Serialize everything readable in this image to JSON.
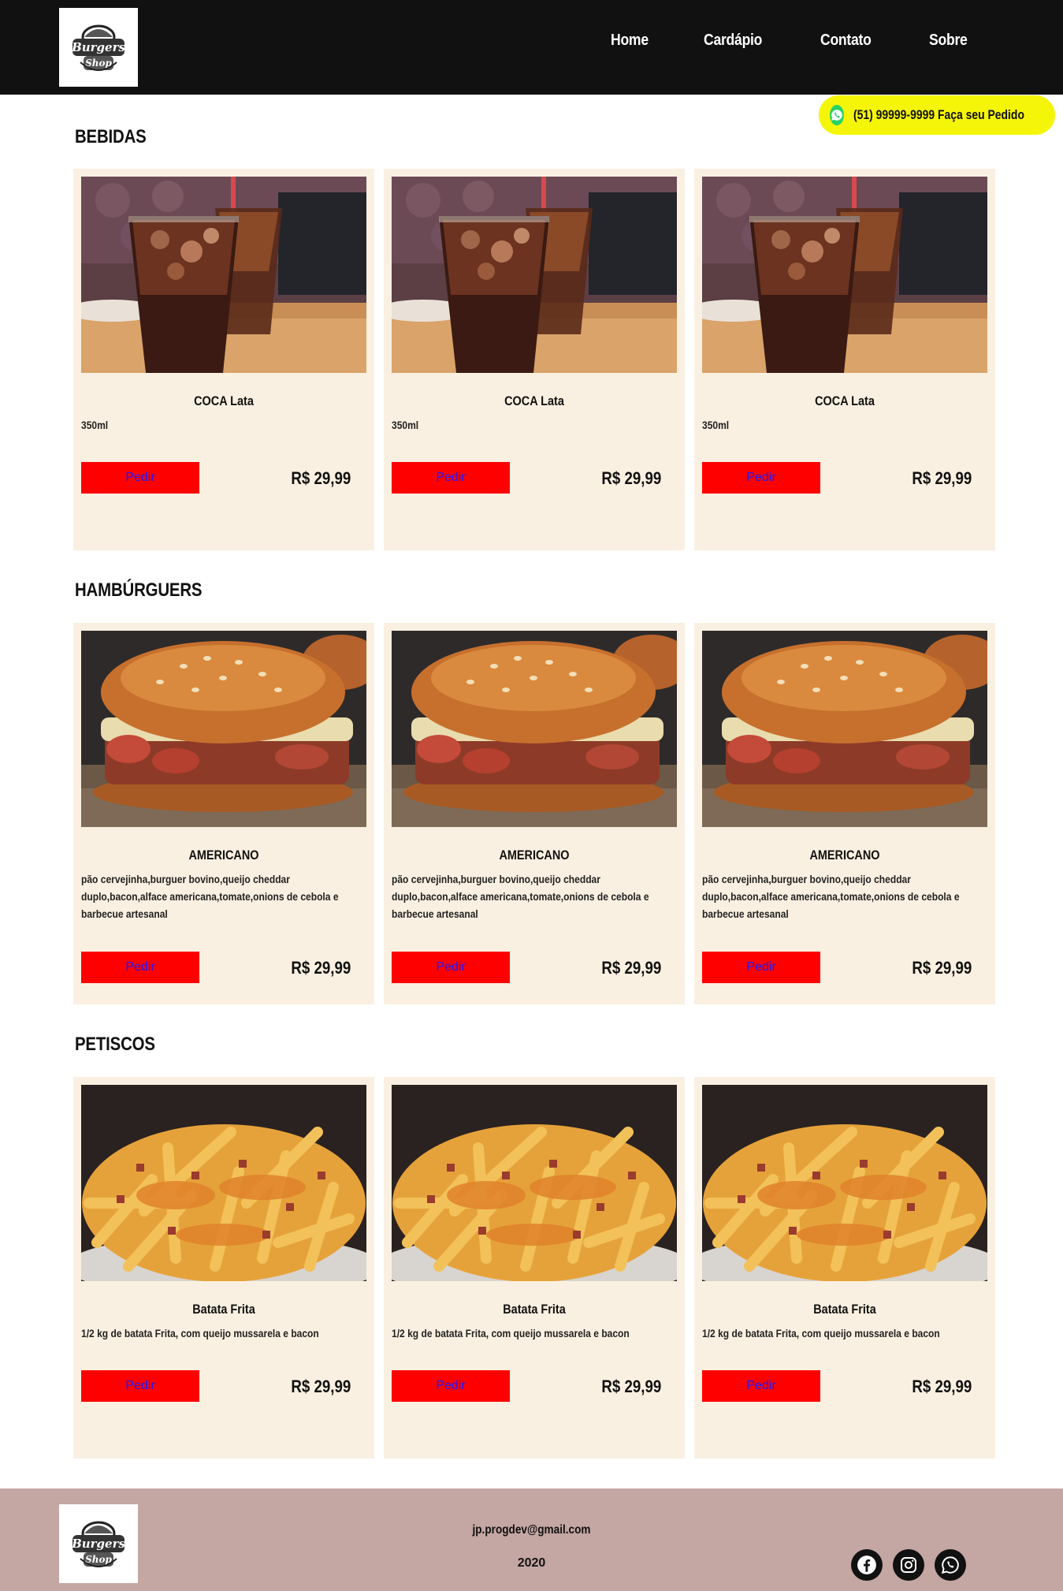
{
  "header": {
    "logo_text": "Burgers Shop",
    "nav": [
      "Home",
      "Cardápio",
      "Contato",
      "Sobre"
    ]
  },
  "whatsapp_float": {
    "label": "(51) 99999-9999 Faça seu Pedido"
  },
  "sections": [
    {
      "title": "BEBIDAS",
      "image": "soda-glass-image",
      "items": [
        {
          "name": "COCA Lata",
          "description": "350ml",
          "button": "Pedir",
          "price": "R$ 29,99"
        },
        {
          "name": "COCA Lata",
          "description": "350ml",
          "button": "Pedir",
          "price": "R$ 29,99"
        },
        {
          "name": "COCA Lata",
          "description": "350ml",
          "button": "Pedir",
          "price": "R$ 29,99"
        }
      ]
    },
    {
      "title": "HAMBÚRGUERS",
      "image": "burger-image",
      "items": [
        {
          "name": "AMERICANO",
          "description": "pão cervejinha,burguer bovino,queijo cheddar duplo,bacon,alface americana,tomate,onions de cebola e barbecue artesanal",
          "button": "Pedir",
          "price": "R$ 29,99"
        },
        {
          "name": "AMERICANO",
          "description": "pão cervejinha,burguer bovino,queijo cheddar duplo,bacon,alface americana,tomate,onions de cebola e barbecue artesanal",
          "button": "Pedir",
          "price": "R$ 29,99"
        },
        {
          "name": "AMERICANO",
          "description": "pão cervejinha,burguer bovino,queijo cheddar duplo,bacon,alface americana,tomate,onions de cebola e barbecue artesanal",
          "button": "Pedir",
          "price": "R$ 29,99"
        }
      ]
    },
    {
      "title": "PETISCOS",
      "image": "fries-image",
      "items": [
        {
          "name": "Batata Frita",
          "description": "1/2 kg de batata Frita, com queijo mussarela e bacon",
          "button": "Pedir",
          "price": "R$ 29,99"
        },
        {
          "name": "Batata Frita",
          "description": "1/2 kg de batata Frita, com queijo mussarela e bacon",
          "button": "Pedir",
          "price": "R$ 29,99"
        },
        {
          "name": "Batata Frita",
          "description": "1/2 kg de batata Frita, com queijo mussarela e bacon",
          "button": "Pedir",
          "price": "R$ 29,99"
        }
      ]
    }
  ],
  "footer": {
    "email": "jp.progdev@gmail.com",
    "year": "2020",
    "social": [
      "facebook-icon",
      "instagram-icon",
      "whatsapp-icon"
    ]
  },
  "colors": {
    "header_bg": "#111111",
    "card_bg": "#faf0e1",
    "button_bg": "#ff0000",
    "button_text": "#1a1aff",
    "whatsapp_float_bg": "#f5f50a",
    "footer_bg": "#c4a6a3"
  }
}
